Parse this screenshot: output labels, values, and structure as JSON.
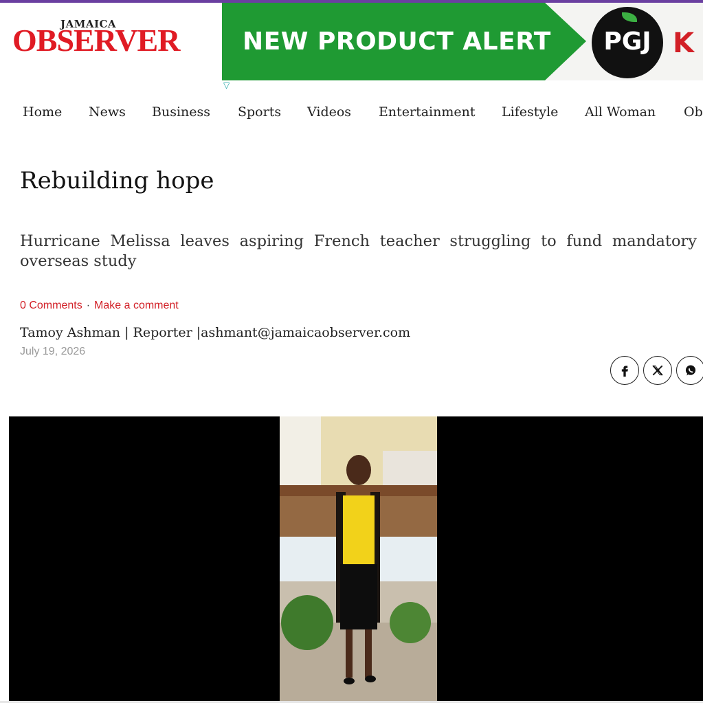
{
  "logo": {
    "top": "JAMAICA",
    "word": "OBSERVER"
  },
  "ad": {
    "headline": "NEW PRODUCT ALERT",
    "brand": "PGJ",
    "extra": "K"
  },
  "nav": [
    "Home",
    "News",
    "Business",
    "Sports",
    "Videos",
    "Entertainment",
    "Lifestyle",
    "All Woman",
    "Ob"
  ],
  "article": {
    "title": "Rebuilding hope",
    "subtitle": "Hurricane Melissa leaves aspiring French teacher struggling to fund mandatory overseas study",
    "comments": "0 Comments",
    "make_comment": "Make a comment",
    "byline": "Tamoy Ashman | Reporter |ashmant@jamaicaobserver.com",
    "date": "July 19, 2026"
  },
  "share": [
    "facebook-icon",
    "x-icon",
    "whatsapp-icon"
  ],
  "colors": {
    "brand_red": "#e01b24",
    "ad_green": "#1f9a33",
    "accent_purple": "#6a3fa0",
    "link_red": "#d21f26"
  }
}
